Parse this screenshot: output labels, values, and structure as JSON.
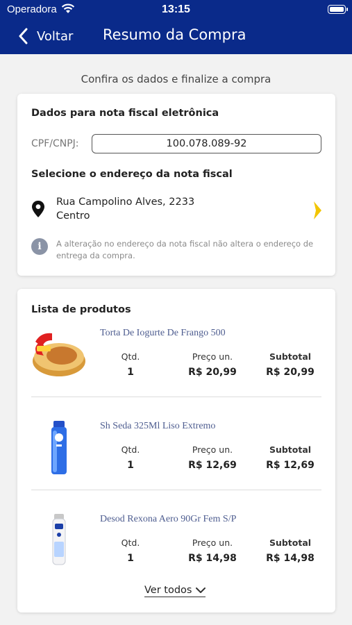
{
  "status_bar": {
    "carrier": "Operadora",
    "time": "13:15"
  },
  "header": {
    "back_label": "Voltar",
    "title": "Resumo da Compra"
  },
  "subtitle": "Confira os dados e finalize a compra",
  "invoice": {
    "title": "Dados para nota fiscal eletrônica",
    "cpf_label": "CPF/CNPJ:",
    "cpf_value": "100.078.089-92",
    "address_title": "Selecione o endereço da nota fiscal",
    "address_line1": "Rua Campolino Alves, 2233",
    "address_line2": "Centro",
    "info_text": "A alteração no endereço da nota fiscal não altera o endereço de entrega da compra."
  },
  "products": {
    "title": "Lista de produtos",
    "columns": {
      "qty": "Qtd.",
      "price": "Preço un.",
      "subtotal": "Subtotal"
    },
    "items": [
      {
        "name": "Torta De Iogurte De Frango 500",
        "qty": "1",
        "price": "R$ 20,99",
        "subtotal": "R$ 20,99",
        "icon": "pie-package-icon"
      },
      {
        "name": "Sh Seda 325Ml Liso Extremo",
        "qty": "1",
        "price": "R$ 12,69",
        "subtotal": "R$ 12,69",
        "icon": "shampoo-bottle-icon"
      },
      {
        "name": "Desod Rexona Aero 90Gr Fem S/P",
        "qty": "1",
        "price": "R$ 14,98",
        "subtotal": "R$ 14,98",
        "icon": "deodorant-can-icon"
      }
    ],
    "see_all": "Ver todos"
  },
  "colors": {
    "header": "#0a2a8a",
    "accent_arrow": "#f2c500",
    "product_name": "#4d5c8f"
  }
}
